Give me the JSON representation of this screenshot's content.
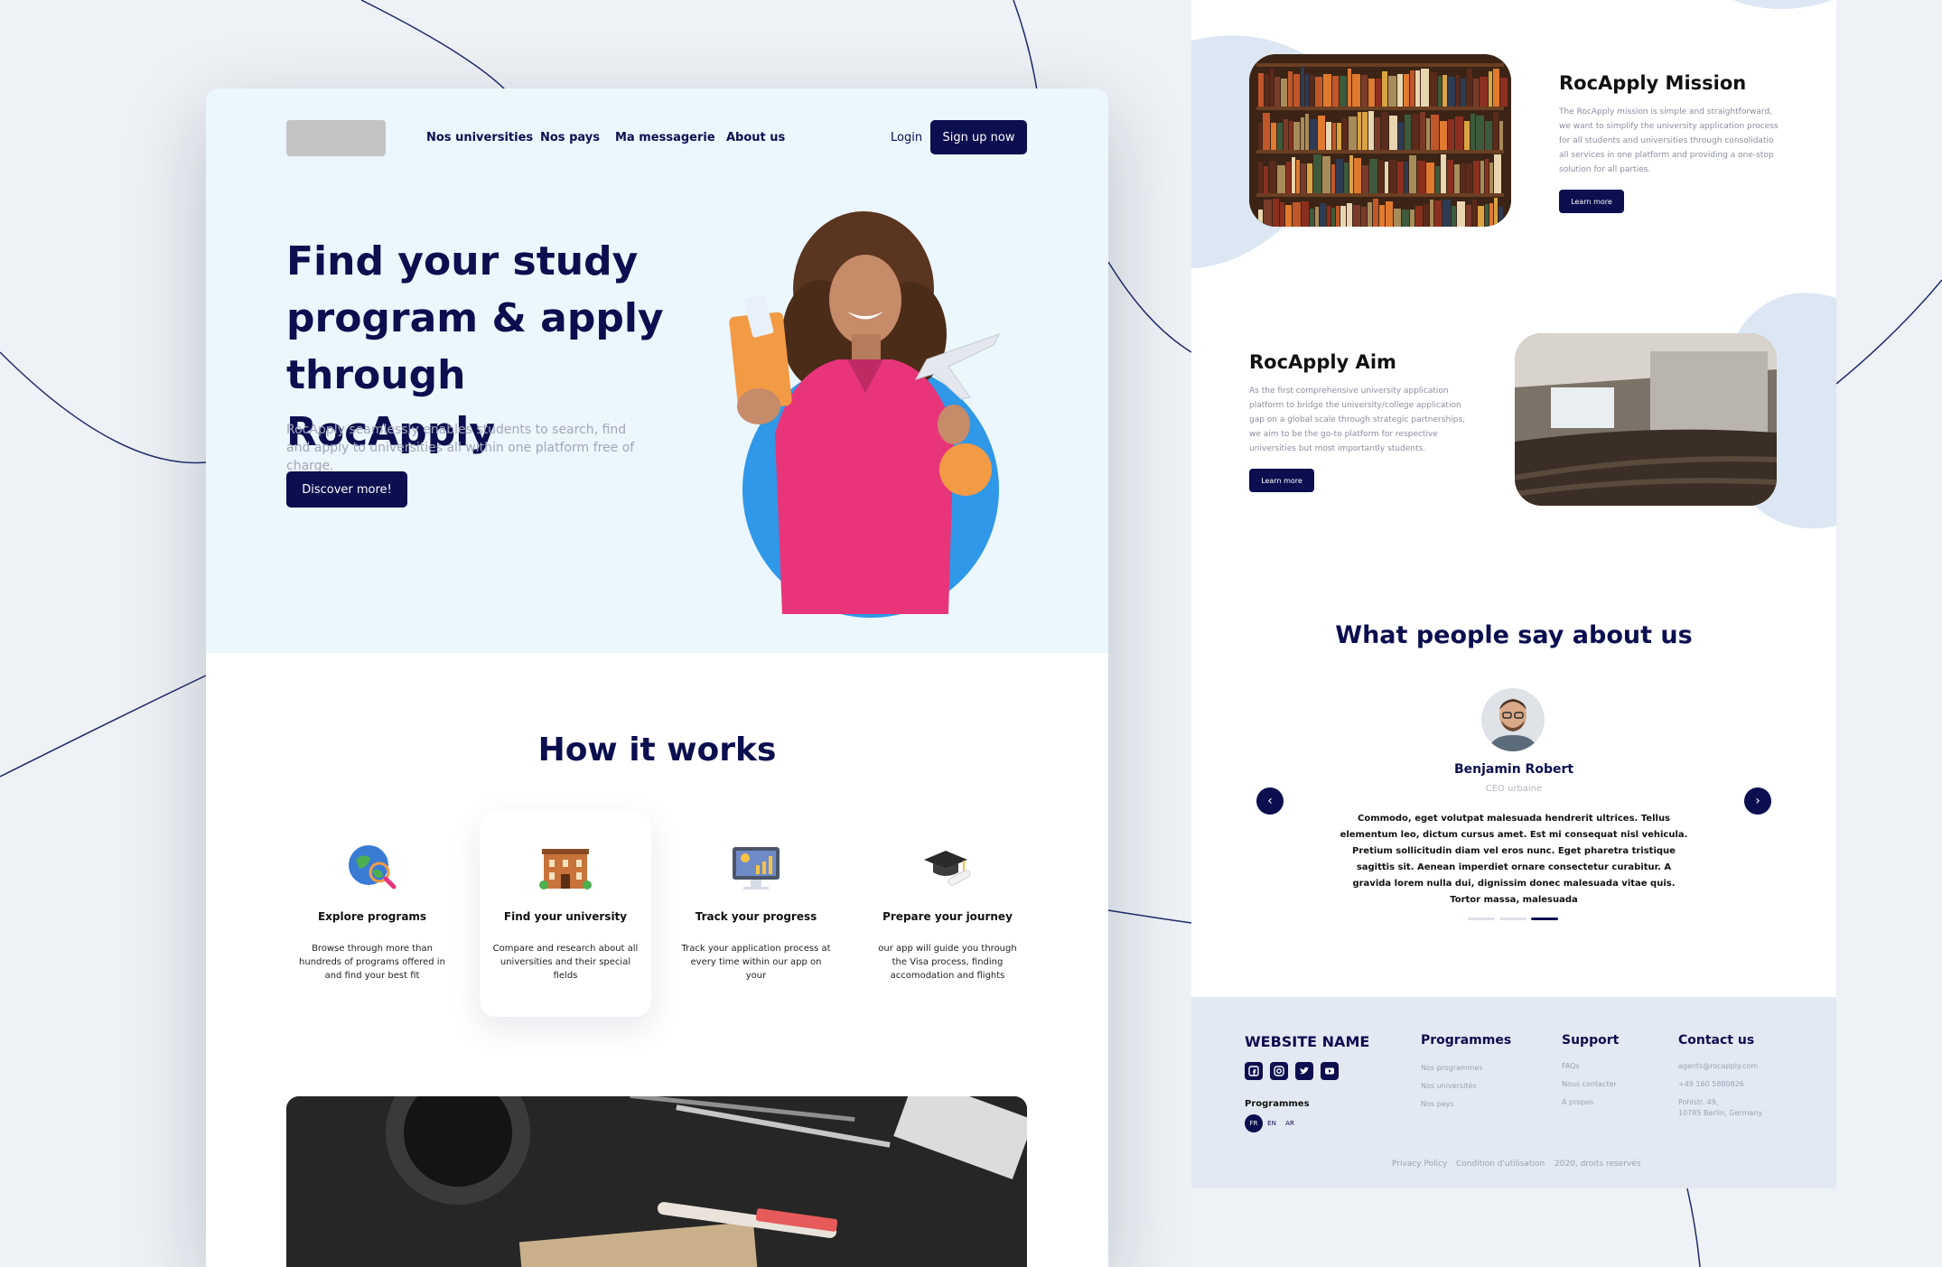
{
  "colors": {
    "navy": "#0b0e4f",
    "hero_bg": "#ebf6fd",
    "blob": "#dce7f3",
    "accent_blue": "#2f98e8",
    "accent_orange": "#f39a45",
    "footer_bg": "#e3e9f2"
  },
  "nav": {
    "logo": "",
    "links": [
      "Nos universities",
      "Nos pays",
      "Ma messagerie",
      "About us"
    ],
    "login": "Login",
    "signup": "Sign up now"
  },
  "hero": {
    "title": "Find your study program & apply through RocApply",
    "subtitle": "RocApply seamlessly enables students to search, find and apply to universities all within one platform free of charge.",
    "cta": "Discover more!"
  },
  "how": {
    "title": "How it works",
    "steps": [
      {
        "icon": "globe-search-icon",
        "title": "Explore programs",
        "desc": "Browse through more than hundreds of programs offered in and find your best fit"
      },
      {
        "icon": "university-building-icon",
        "title": "Find your university",
        "desc": "Compare and research about all universities and their special fields"
      },
      {
        "icon": "progress-chart-icon",
        "title": "Track your progress",
        "desc": "Track your application process at every time within our app on your"
      },
      {
        "icon": "graduation-cap-icon",
        "title": "Prepare your journey",
        "desc": "our app will guide you through the Visa process, finding accomodation and flights"
      }
    ]
  },
  "mission": {
    "title": "RocApply Mission",
    "desc": "The RocApply mission is simple and straightforward, we want to simplify the university application process for all students and universities through consolidatio all services in one platform and providing a one-stop solution for all parties.",
    "cta": "Learn more"
  },
  "aim": {
    "title": "RocApply Aim",
    "desc": "As the first comprehensive university application platform to bridge the university/college application gap on a global scale through strategic partnerships, we aim to be the go-to platform for respective universities but most importantly students.",
    "cta": "Learn more"
  },
  "testimonials": {
    "title": "What people say about us",
    "name": "Benjamin Robert",
    "role": "CEO urbaine",
    "quote": "Commodo, eget volutpat malesuada hendrerit ultrices. Tellus elementum leo, dictum cursus amet. Est mi consequat nisl vehicula. Pretium sollicitudin diam vel eros nunc. Eget pharetra tristique sagittis sit. Aenean imperdiet ornare consectetur curabitur. A gravida lorem nulla dui, dignissim donec malesuada vitae quis. Tortor massa, malesuada",
    "prev": "‹",
    "next": "›",
    "active_slide": 3,
    "slide_count": 3
  },
  "footer": {
    "brand": "WEBSITE NAME",
    "social": [
      "facebook-icon",
      "instagram-icon",
      "twitter-icon",
      "youtube-icon"
    ],
    "lang_title": "Programmes",
    "langs": [
      "FR",
      "EN",
      "AR"
    ],
    "col_programmes": {
      "title": "Programmes",
      "links": [
        "Nos programmes",
        "Nos universités",
        "Nos pays"
      ]
    },
    "col_support": {
      "title": "Support",
      "links": [
        "FAQs",
        "Nous contacter",
        "A propos"
      ]
    },
    "col_contact": {
      "title": "Contact us",
      "email": "agents@rocapply.com",
      "phone": "+49 160 5880826",
      "address_1": "Pohlstr. 49,",
      "address_2": "10785 Berlin, Germany"
    },
    "legal": [
      "Privacy Policy",
      "Condition d'utilisation",
      "2020, droits reservés"
    ]
  }
}
